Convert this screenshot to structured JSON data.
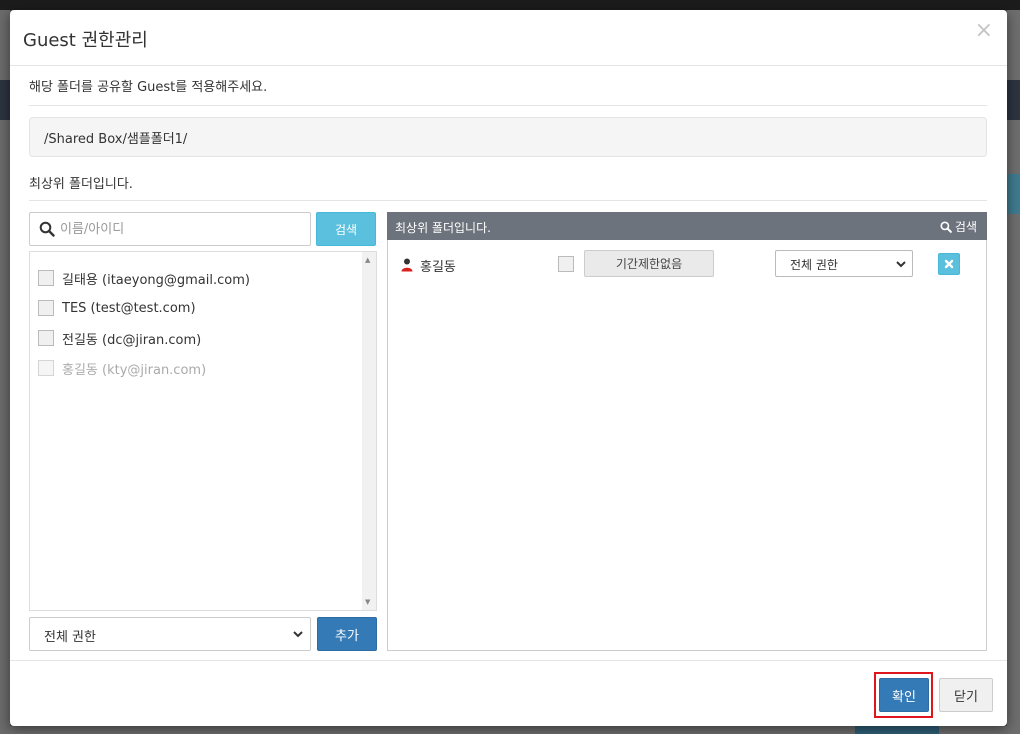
{
  "modal": {
    "title": "Guest 권한관리",
    "description": "해당 폴더를 공유할 Guest를 적용해주세요.",
    "path": "/Shared Box/샘플폴더1/",
    "root_notice": "최상위 폴더입니다."
  },
  "left_panel": {
    "search_placeholder": "이름/아이디",
    "search_button": "검색",
    "users": [
      {
        "label": "길태용 (itaeyong@gmail.com)",
        "disabled": false
      },
      {
        "label": "TES (test@test.com)",
        "disabled": false
      },
      {
        "label": "전길동 (dc@jiran.com)",
        "disabled": false
      },
      {
        "label": "홍길동 (kty@jiran.com)",
        "disabled": true
      }
    ],
    "permission_select": "전체 권한",
    "add_button": "추가"
  },
  "right_panel": {
    "header_title": "최상위 폴더입니다.",
    "search_label": "검색",
    "rows": [
      {
        "name": "홍길동",
        "period_button": "기간제한없음",
        "permission": "전체 권한"
      }
    ]
  },
  "footer": {
    "confirm_button": "확인",
    "close_button": "닫기"
  },
  "colors": {
    "primary": "#337ab7",
    "info": "#5bc0de",
    "header_gray": "#6d737c",
    "highlight_red": "#e0141b"
  }
}
